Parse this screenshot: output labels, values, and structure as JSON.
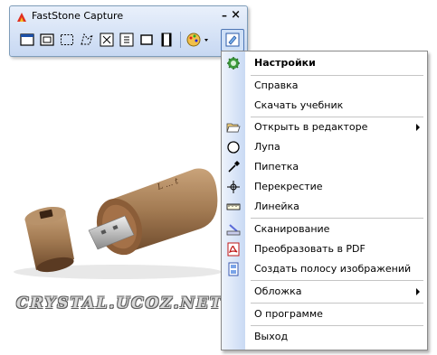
{
  "window": {
    "title": "FastStone Capture",
    "minimize_label": "–",
    "close_label": "×"
  },
  "toolbar": {
    "tools": [
      {
        "icon": "capture-window-icon"
      },
      {
        "icon": "capture-object-icon"
      },
      {
        "icon": "capture-rectangle-icon"
      },
      {
        "icon": "capture-freehand-icon"
      },
      {
        "icon": "capture-fullscreen-icon"
      },
      {
        "icon": "capture-scrolling-icon"
      },
      {
        "icon": "capture-fixed-region-icon"
      },
      {
        "icon": "capture-video-icon"
      },
      {
        "icon": "output-palette-icon"
      },
      {
        "icon": "menu-icon"
      }
    ]
  },
  "watermark": "CRYSTAL.UCOZ.NET",
  "menu": {
    "items": [
      {
        "label": "Настройки",
        "icon": "settings-gear-icon",
        "bold": true
      },
      {
        "label": "Справка",
        "icon": ""
      },
      {
        "label": "Скачать учебник",
        "icon": ""
      },
      {
        "label": "Открыть в редакторе",
        "icon": "open-folder-icon",
        "submenu": true
      },
      {
        "label": "Лупа",
        "icon": "magnifier-icon"
      },
      {
        "label": "Пипетка",
        "icon": "eyedropper-icon"
      },
      {
        "label": "Перекрестие",
        "icon": "crosshair-icon"
      },
      {
        "label": "Линейка",
        "icon": "ruler-icon"
      },
      {
        "label": "Сканирование",
        "icon": "scanner-icon"
      },
      {
        "label": "Преобразовать в PDF",
        "icon": "pdf-icon"
      },
      {
        "label": "Создать полосу изображений",
        "icon": "image-strip-icon"
      },
      {
        "label": "Обложка",
        "icon": "",
        "submenu": true
      },
      {
        "label": "О программе",
        "icon": ""
      },
      {
        "label": "Выход",
        "icon": ""
      }
    ]
  }
}
